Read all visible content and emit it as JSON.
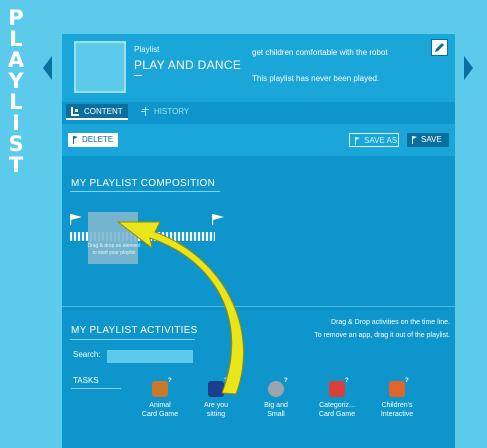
{
  "side_title": [
    "P",
    "L",
    "A",
    "Y",
    "L",
    "I",
    "S",
    "T"
  ],
  "header": {
    "label": "Playlist",
    "name": "PLAY AND DANCE",
    "description": "get children comfortable with the robot",
    "status": "This playlist has never been played."
  },
  "tabs": [
    {
      "label": "CONTENT",
      "active": true
    },
    {
      "label": "HISTORY",
      "active": false
    }
  ],
  "toolbar": {
    "delete_label": "DELETE",
    "save_as_label": "SAVE AS",
    "save_label": "SAVE"
  },
  "composition": {
    "title": "MY PLAYLIST COMPOSITION",
    "drop_hint": "Drag & drop an element to start your playlist"
  },
  "activities": {
    "title": "MY PLAYLIST ACTIVITIES",
    "instructions": [
      "Drag & Drop activities on the time line.",
      "To remove an app, drag it out of the playlist."
    ],
    "search_label": "Search:",
    "search_value": "",
    "tasks_label": "TASKS",
    "apps": [
      {
        "name": "Animal Card Game",
        "line1": "Animal",
        "line2": "Card Game",
        "icon": "animal-icon",
        "color": "#c8792a"
      },
      {
        "name": "Are you sitting",
        "line1": "Are you",
        "line2": "sitting",
        "icon": "sitting-icon",
        "color": "#1b3f8f"
      },
      {
        "name": "Big and Small",
        "line1": "Big and",
        "line2": "Small",
        "icon": "big-small-icon",
        "color": "#9aa5ad"
      },
      {
        "name": "Categoriz... Card Game",
        "line1": "Categoriz...",
        "line2": "Card Game",
        "icon": "categorize-icon",
        "color": "#d9403a"
      },
      {
        "name": "Children's Interactive",
        "line1": "Children's",
        "line2": "Interactive",
        "icon": "children-icon",
        "color": "#e0662e"
      }
    ]
  },
  "colors": {
    "background": "#5ccaeb",
    "panel": "#0e95cb",
    "dark": "#0a6f9e",
    "arrow_fill": "#e8e61a"
  }
}
